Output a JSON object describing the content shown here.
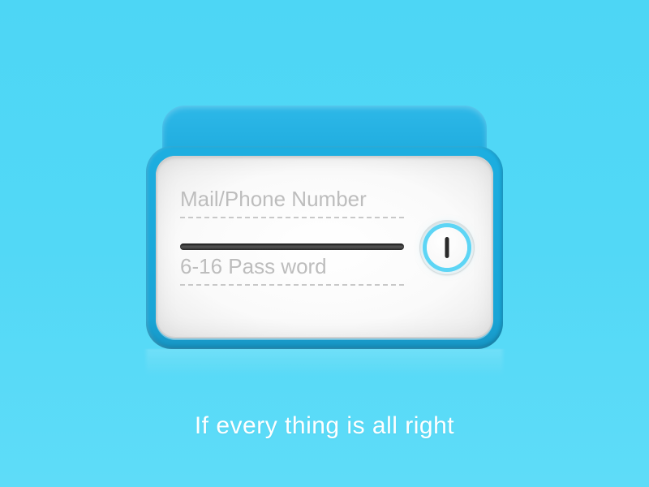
{
  "form": {
    "identifier": {
      "placeholder": "Mail/Phone Number",
      "value": ""
    },
    "password": {
      "placeholder": "6-16 Pass word",
      "value": ""
    }
  },
  "caption": "If every thing is all right",
  "colors": {
    "background": "#4dd6f5",
    "accent": "#1daee0",
    "ring": "#5dd5f5"
  }
}
